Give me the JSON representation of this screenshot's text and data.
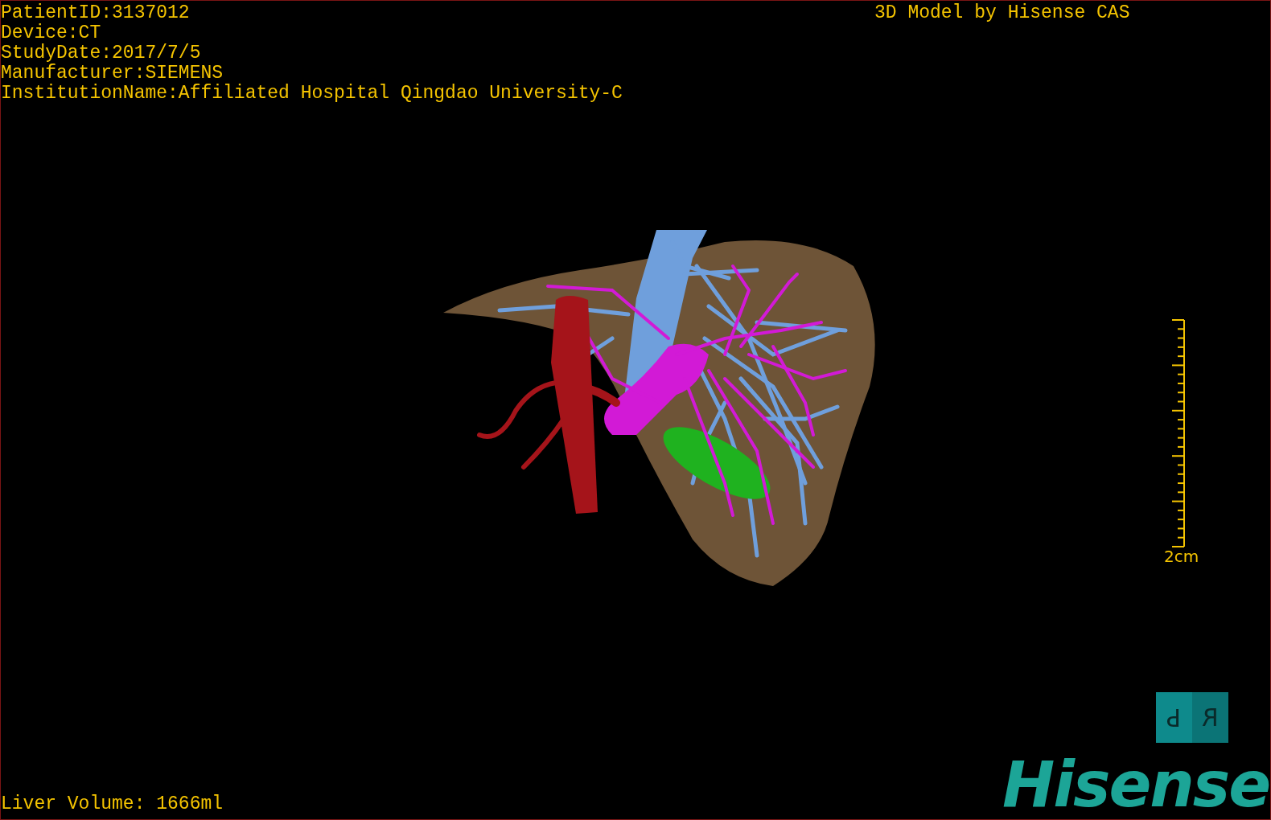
{
  "patient_info": [
    "PatientID:3137012",
    "Device:CT",
    "StudyDate:2017/7/5",
    "Manufacturer:SIEMENS",
    "InstitutionName:Affiliated Hospital Qingdao University-C"
  ],
  "model_credit": "3D Model by Hisense CAS",
  "scale_bar": {
    "label": "2cm"
  },
  "orientation_cube": {
    "faces": [
      "P",
      "R"
    ]
  },
  "logo": "Hisense",
  "liver_volume": "Liver Volume: 1666ml"
}
